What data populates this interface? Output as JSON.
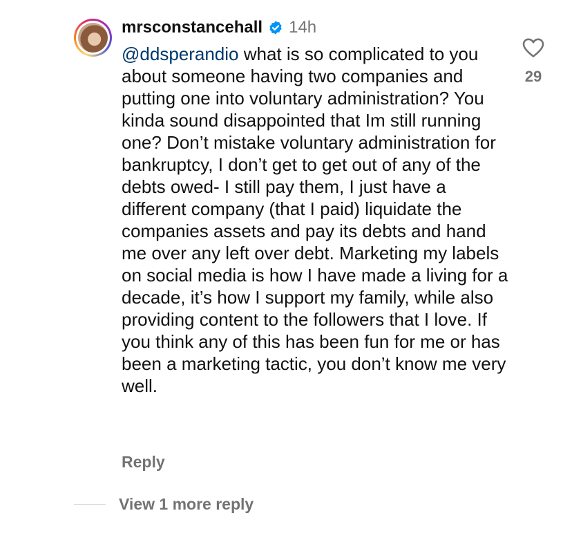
{
  "comment": {
    "username": "mrsconstancehall",
    "verified_icon": "verified-badge-icon",
    "time": "14h",
    "mention": "@ddsperandio",
    "text": " what is so complicated to you about someone having two companies and putting one into voluntary administration? You kinda sound disappointed that Im still running one? Don’t mistake voluntary administration for bankruptcy, I don’t get to get out of any of the debts owed- I still pay them, I just have a different company (that I paid) liquidate the companies assets and pay its debts and hand me over any left over debt. Marketing my labels on social media is how I have made a living for a decade, it’s how I support my family, while also providing content to the followers that I love. If you think any of this has been fun for me or has been a marketing tactic, you don’t know me very well.",
    "like_icon": "heart-outline-icon",
    "like_count": "29",
    "reply_label": "Reply",
    "view_more_label": "View 1 more reply"
  },
  "colors": {
    "verified_blue": "#0095f6",
    "mention_blue": "#00376b",
    "secondary_gray": "#737373",
    "primary_text": "#111111"
  }
}
